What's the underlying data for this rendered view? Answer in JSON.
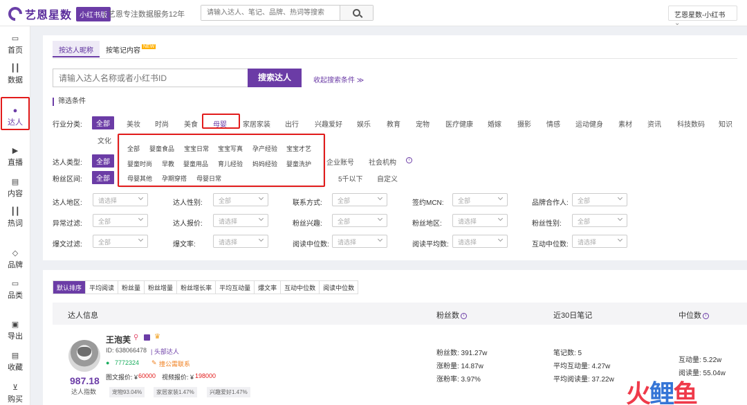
{
  "header": {
    "brand": "艺恩星数",
    "tag": "小红书版",
    "slogan": "| 艺恩专注数据服务12年",
    "search_placeholder": "请输入达人、笔记、品牌、热词等搜索",
    "account": "艺恩星数-小红书"
  },
  "sidebar": {
    "items": [
      {
        "label": "首页",
        "icon": "monitor-icon"
      },
      {
        "label": "数据",
        "icon": "bar-chart-icon"
      },
      {
        "label": "达人",
        "icon": "person-icon"
      },
      {
        "label": "直播",
        "icon": "play-icon"
      },
      {
        "label": "内容",
        "icon": "document-icon"
      },
      {
        "label": "热词",
        "icon": "trend-icon"
      },
      {
        "label": "品牌",
        "icon": "diamond-icon"
      },
      {
        "label": "品类",
        "icon": "box-icon"
      },
      {
        "label": "导出",
        "icon": "export-icon"
      },
      {
        "label": "收藏",
        "icon": "bookmark-icon"
      },
      {
        "label": "购买",
        "icon": "cart-icon"
      }
    ]
  },
  "tabs": [
    {
      "label": "按达人昵称"
    },
    {
      "label": "按笔记内容",
      "badge": "NEW"
    }
  ],
  "search": {
    "placeholder": "请输入达人名称或者小红书ID",
    "button": "搜索达人",
    "collapse": "收起搜索条件 ≫"
  },
  "filter": {
    "title": "筛选条件",
    "industry_label": "行业分类:",
    "industry": [
      "全部",
      "美妆",
      "时尚",
      "美食",
      "母婴",
      "家居家装",
      "出行",
      "兴趣爱好",
      "娱乐",
      "教育",
      "宠物",
      "医疗健康",
      "婚嫁",
      "摄影",
      "情感",
      "运动健身",
      "素材",
      "资讯",
      "科技数码",
      "知识",
      "文化"
    ],
    "type_label": "达人类型:",
    "type_all": "全部",
    "type_visible": [
      "企业账号",
      "社会机构"
    ],
    "fans_label": "粉丝区间:",
    "fans_all": "全部",
    "fans_visible": [
      "5千以下",
      "自定义"
    ],
    "sub_categories": [
      [
        "全部",
        "婴童食品",
        "宝宝日常",
        "宝宝写真",
        "孕产经验",
        "宝宝才艺"
      ],
      [
        "婴童时尚",
        "早教",
        "婴童用品",
        "育儿经验",
        "妈妈经验",
        "婴童洗护"
      ],
      [
        "母婴其他",
        "孕期穿搭",
        "母婴日常"
      ]
    ],
    "selects": [
      [
        {
          "label": "达人地区:",
          "value": "请选择"
        },
        {
          "label": "达人性别:",
          "value": "全部"
        },
        {
          "label": "联系方式:",
          "value": "全部"
        },
        {
          "label": "签约MCN:",
          "value": "全部"
        },
        {
          "label": "品牌合作人:",
          "value": "全部"
        }
      ],
      [
        {
          "label": "异常过滤:",
          "value": "全部"
        },
        {
          "label": "达人报价:",
          "value": "请选择"
        },
        {
          "label": "粉丝兴趣:",
          "value": "全部"
        },
        {
          "label": "粉丝地区:",
          "value": "请选择"
        },
        {
          "label": "粉丝性别:",
          "value": "全部"
        }
      ],
      [
        {
          "label": "爆文过滤:",
          "value": "全部"
        },
        {
          "label": "爆文率:",
          "value": "请选择"
        },
        {
          "label": "阅读中位数:",
          "value": "请选择"
        },
        {
          "label": "阅读平均数:",
          "value": "请选择"
        },
        {
          "label": "互动中位数:",
          "value": "请选择"
        }
      ]
    ]
  },
  "results": {
    "sort_tabs": [
      "默认排序",
      "平均阅读",
      "粉丝量",
      "粉丝增量",
      "粉丝增长率",
      "平均互动量",
      "爆文率",
      "互动中位数",
      "阅读中位数"
    ],
    "columns": [
      "达人信息",
      "粉丝数",
      "近30日笔记",
      "中位数"
    ],
    "row": {
      "name": "王泡芙",
      "id": "ID: 638066478",
      "level": "| 头部达人",
      "wechat": "7772324",
      "contact": "撞公需联系",
      "price_text": "图文报价: ¥",
      "price_text_val": "60000",
      "price_video": "视频报价: ¥",
      "price_video_val": "198000",
      "score": "987.18",
      "score_label": "达人指数",
      "tags": [
        "宠物93.04%",
        "家居家装1.47%",
        "兴趣爱好1.47%"
      ],
      "fans": [
        "粉丝数: 391.27w",
        "涨粉量: 14.87w",
        "涨粉率: 3.97%"
      ],
      "notes": [
        "笔记数: 5",
        "平均互动量: 4.27w",
        "平均阅读量: 37.22w"
      ],
      "median": [
        "互动量: 5.22w",
        "阅读量: 55.04w"
      ]
    }
  },
  "watermark": {
    "a": "火",
    "b": "鲤",
    "c": "鱼"
  }
}
